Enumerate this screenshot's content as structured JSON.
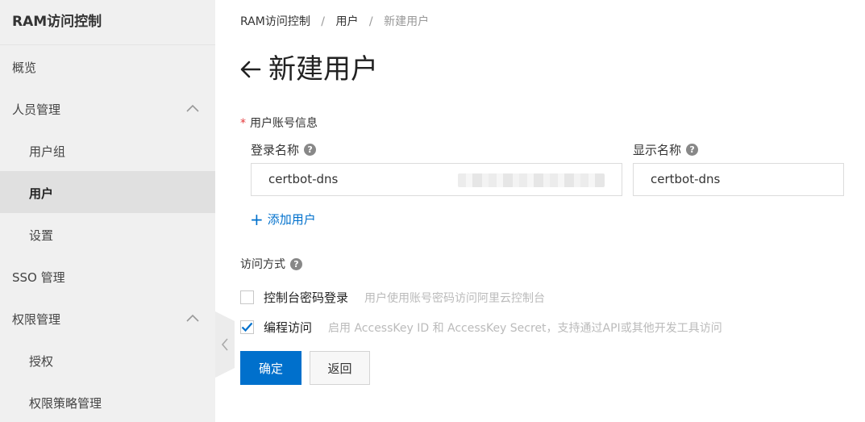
{
  "sidebar": {
    "title": "RAM访问控制",
    "items": [
      {
        "label": "概览",
        "level": 1
      },
      {
        "label": "人员管理",
        "level": 1,
        "expanded": true
      },
      {
        "label": "用户组",
        "level": 2
      },
      {
        "label": "用户",
        "level": 2,
        "active": true
      },
      {
        "label": "设置",
        "level": 2
      },
      {
        "label": "SSO 管理",
        "level": 1
      },
      {
        "label": "权限管理",
        "level": 1,
        "expanded": true
      },
      {
        "label": "授权",
        "level": 2
      },
      {
        "label": "权限策略管理",
        "level": 2
      }
    ]
  },
  "breadcrumb": {
    "items": [
      "RAM访问控制",
      "用户",
      "新建用户"
    ],
    "separator": "/"
  },
  "page": {
    "title": "新建用户"
  },
  "form": {
    "account_section_label": "用户账号信息",
    "login_name_label": "登录名称",
    "display_name_label": "显示名称",
    "login_name_value": "certbot-dns",
    "display_name_value": "certbot-dns",
    "add_user_label": "添加用户",
    "access_section_label": "访问方式",
    "options": [
      {
        "label": "控制台密码登录",
        "description": "用户使用账号密码访问阿里云控制台",
        "checked": false
      },
      {
        "label": "编程访问",
        "description": "启用 AccessKey ID 和 AccessKey Secret，支持通过API或其他开发工具访问",
        "checked": true
      }
    ],
    "confirm_label": "确定",
    "back_label": "返回"
  },
  "colors": {
    "primary": "#0070cc",
    "required": "#e4393c",
    "sidebar_bg": "#f0f0f0",
    "sidebar_active_bg": "#e0e0e0"
  },
  "icons": {
    "help": "question-circle-icon",
    "back": "arrow-left-icon",
    "expand": "chevron-up-icon",
    "collapse_sidebar": "chevron-left-icon",
    "check": "checkmark-icon",
    "add": "plus-icon"
  }
}
